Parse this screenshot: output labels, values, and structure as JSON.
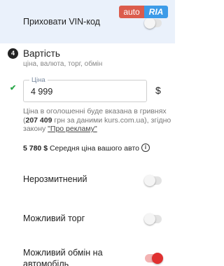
{
  "hide_vin": {
    "label": "Приховати VIN-код",
    "enabled": false
  },
  "logo": {
    "part1": "auto",
    "part2": "RIA"
  },
  "price_section": {
    "step": "4",
    "title": "Вартість",
    "subtitle": "ціна, валюта, торг, обмін",
    "field_label": "Ціна",
    "field_value": "4 999",
    "currency": "$",
    "note_part1": "Ціна в оголошенні буде вказана в гривнях (",
    "note_uah": "207 409",
    "note_part2": " грн за даними kurs.com.ua), згідно закону ",
    "note_link": "\"Про рекламу\"",
    "avg_value": "5 780 $",
    "avg_label": " Середня ціна вашого авто",
    "info_icon_glyph": "i"
  },
  "options": {
    "not_cleared": {
      "label": "Нерозмитнений",
      "enabled": false
    },
    "bargain": {
      "label": "Можливий торг",
      "enabled": false
    },
    "exchange": {
      "label_line1": "Можливий обмін на",
      "label_line2": "автомобіль",
      "enabled": true
    }
  },
  "colors": {
    "topbar_bg": "#eaf1fb",
    "toggle_on": "#e03030",
    "check": "#2aa84a",
    "logo_red": "#db5c4c",
    "logo_blue": "#3c9be8"
  }
}
